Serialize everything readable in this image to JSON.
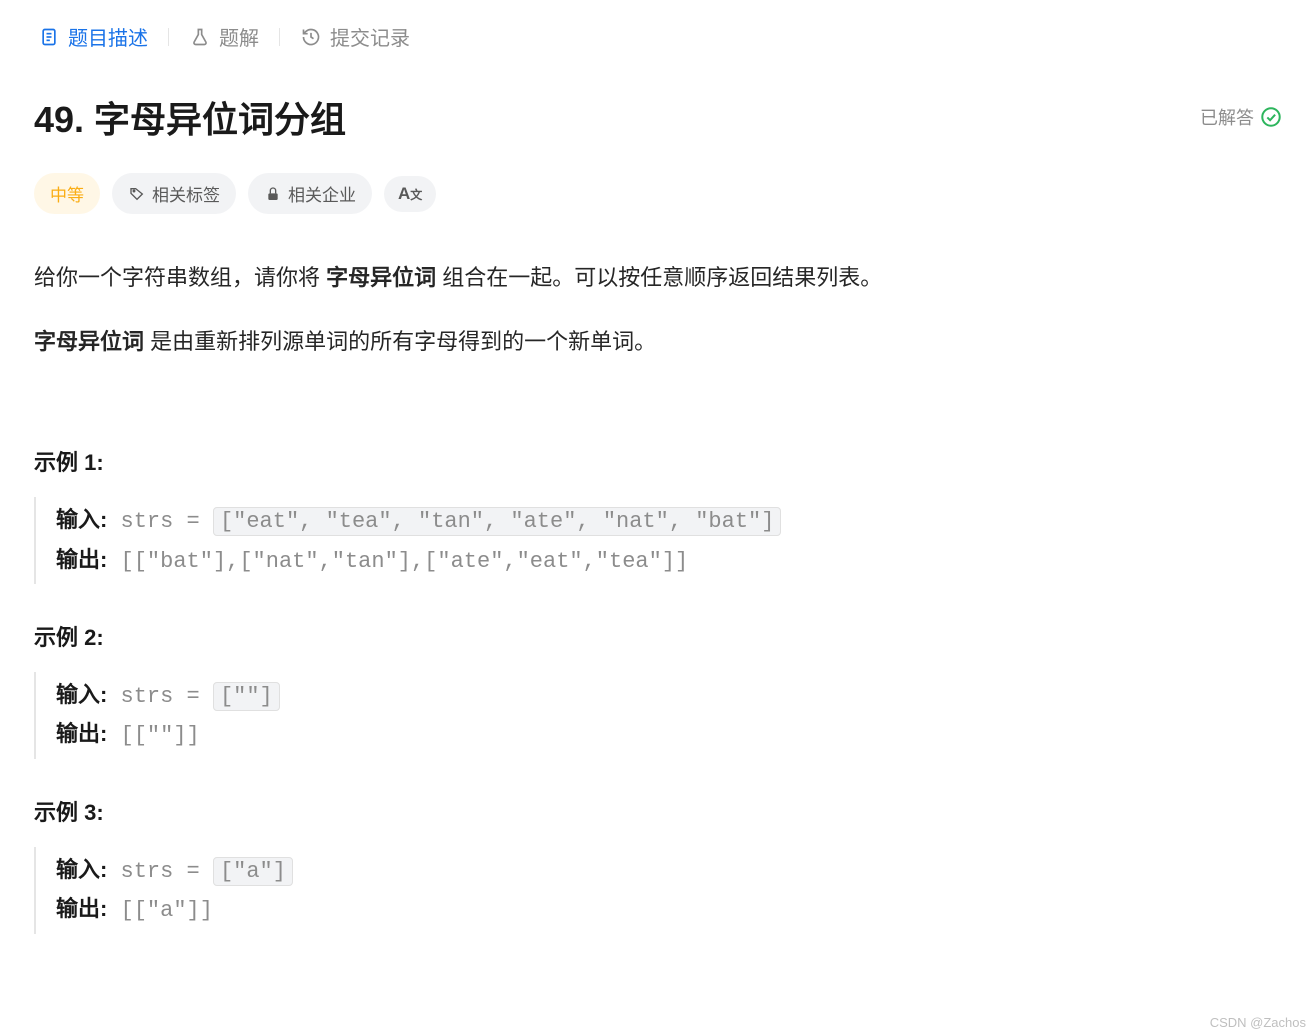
{
  "tabs": {
    "description": "题目描述",
    "solution": "题解",
    "submissions": "提交记录"
  },
  "problem": {
    "title": "49. 字母异位词分组",
    "solvedLabel": "已解答",
    "difficulty": "中等",
    "tagsLabel": "相关标签",
    "companiesLabel": "相关企业",
    "fontSizeLabel": "A",
    "fontSizeSub": "文"
  },
  "description": {
    "line1_prefix": "给你一个字符串数组，请你将 ",
    "line1_bold": "字母异位词",
    "line1_suffix": " 组合在一起。可以按任意顺序返回结果列表。",
    "line2_bold": "字母异位词",
    "line2_suffix": " 是由重新排列源单词的所有字母得到的一个新单词。"
  },
  "examples": [
    {
      "heading": "示例 1:",
      "inputLabel": "输入:",
      "inputPrefix": "strs = ",
      "inputCode": "[\"eat\", \"tea\", \"tan\", \"ate\", \"nat\", \"bat\"]",
      "outputLabel": "输出:",
      "outputValue": "[[\"bat\"],[\"nat\",\"tan\"],[\"ate\",\"eat\",\"tea\"]]"
    },
    {
      "heading": "示例 2:",
      "inputLabel": "输入:",
      "inputPrefix": "strs = ",
      "inputCode": "[\"\"]",
      "outputLabel": "输出:",
      "outputValue": "[[\"\"]]"
    },
    {
      "heading": "示例 3:",
      "inputLabel": "输入:",
      "inputPrefix": "strs = ",
      "inputCode": "[\"a\"]",
      "outputLabel": "输出:",
      "outputValue": "[[\"a\"]]"
    }
  ],
  "watermark": "CSDN @Zachos"
}
